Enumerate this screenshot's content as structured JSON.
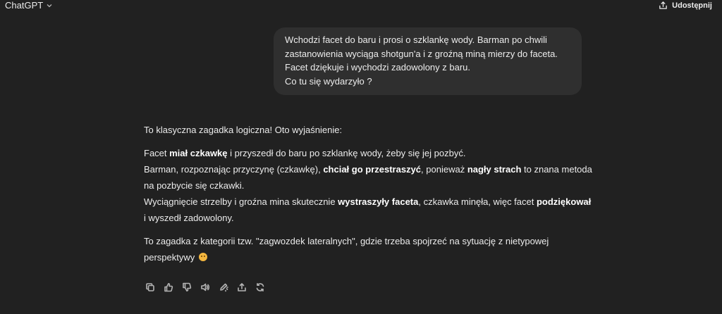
{
  "header": {
    "title": "ChatGPT",
    "share_label": "Udostępnij"
  },
  "user_message": {
    "lines": [
      "Wchodzi facet do baru i prosi o szklankę wody. Barman po chwili",
      "zastanowienia wyciąga shotgun'a i z groźną miną mierzy do faceta.",
      "Facet dziękuje i wychodzi zadowolony z baru.",
      "Co tu się wydarzyło ?"
    ]
  },
  "assistant_message": {
    "intro": "To klasyczna zagadka logiczna! Oto wyjaśnienie:",
    "p1_l1_a": "Facet ",
    "p1_l1_b": "miał czkawkę",
    "p1_l1_c": " i przyszedł do baru po szklankę wody, żeby się jej pozbyć.",
    "p1_l2_a": "Barman, rozpoznając przyczynę (czkawkę), ",
    "p1_l2_b": "chciał go przestraszyć",
    "p1_l2_c": ", ponieważ ",
    "p1_l2_d": "nagły strach",
    "p1_l2_e": " to znana metoda na pozbycie się czkawki.",
    "p1_l3_a": "Wyciągnięcie strzelby i groźna mina skutecznie ",
    "p1_l3_b": "wystraszyły faceta",
    "p1_l3_c": ", czkawka minęła, więc facet ",
    "p1_l3_d": "podziękował",
    "p1_l3_e": " i wyszedł zadowolony.",
    "p2": "To zagadka z kategorii tzw. \"zagwozdek lateralnych\", gdzie trzeba spojrzeć na sytuację z nietypowej perspektywy"
  },
  "actions": {
    "icons": [
      "copy-icon",
      "thumbs-up-icon",
      "thumbs-down-icon",
      "read-aloud-icon",
      "edit-canvas-icon",
      "share-icon",
      "regenerate-icon"
    ]
  },
  "colors": {
    "background": "#212121",
    "user_bubble": "#2f2f2f",
    "text": "#ececec",
    "icon": "#b4b4b4"
  }
}
